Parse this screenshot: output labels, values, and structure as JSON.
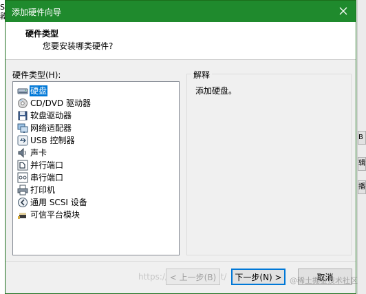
{
  "background": {
    "left_text": "S\n器",
    "right_buttons": [
      "B",
      "辑",
      "播"
    ]
  },
  "dialog": {
    "title": "添加硬件向导",
    "header_title": "硬件类型",
    "header_subtitle": "您要安装哪类硬件?",
    "list_label": "硬件类型(H):",
    "items": [
      {
        "label": "硬盘",
        "icon": "hard-disk-icon"
      },
      {
        "label": "CD/DVD 驱动器",
        "icon": "cd-dvd-icon"
      },
      {
        "label": "软盘驱动器",
        "icon": "floppy-icon"
      },
      {
        "label": "网络适配器",
        "icon": "network-adapter-icon"
      },
      {
        "label": "USB 控制器",
        "icon": "usb-icon"
      },
      {
        "label": "声卡",
        "icon": "sound-card-icon"
      },
      {
        "label": "并行端口",
        "icon": "parallel-port-icon"
      },
      {
        "label": "串行端口",
        "icon": "serial-port-icon"
      },
      {
        "label": "打印机",
        "icon": "printer-icon"
      },
      {
        "label": "通用 SCSI 设备",
        "icon": "scsi-icon"
      },
      {
        "label": "可信平台模块",
        "icon": "tpm-icon"
      }
    ],
    "selected_index": 0,
    "explanation_title": "解释",
    "explanation_text": "添加硬盘。",
    "buttons": {
      "back": "< 上一步(B)",
      "next": "下一步(N) >",
      "cancel": "取消"
    },
    "accent_color": "#1f8a2d",
    "selection_color": "#0078d7"
  },
  "watermark": {
    "url": "https://blog.csdn.net/",
    "brand": "@稀土掘金技术社区"
  }
}
